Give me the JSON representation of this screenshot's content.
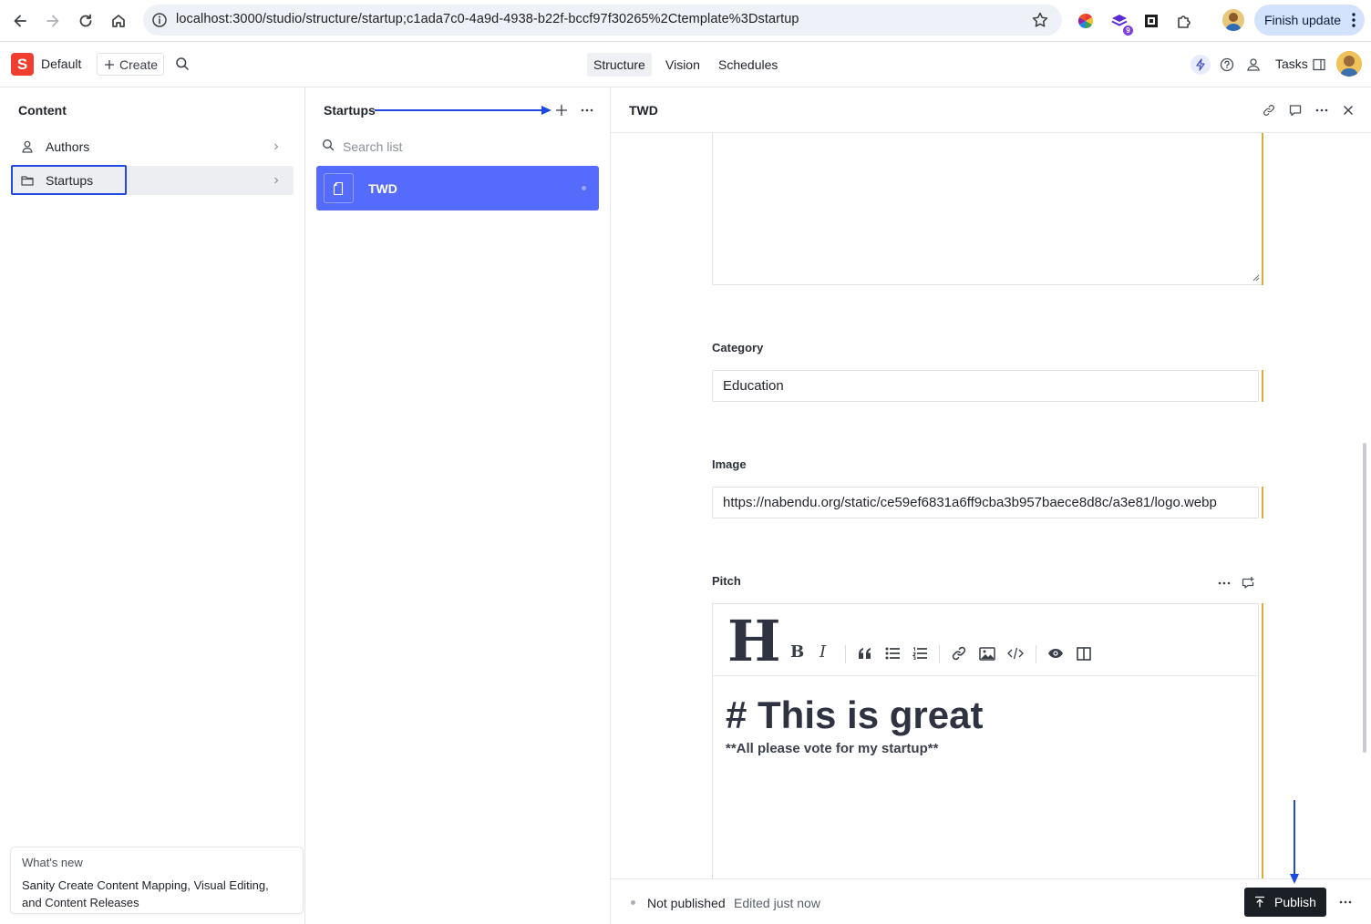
{
  "browser": {
    "url": "localhost:3000/studio/structure/startup;c1ada7c0-4a9d-4938-b22f-bccf97f30265%2Ctemplate%3Dstartup",
    "extension_badge": "9",
    "finish_update_label": "Finish update"
  },
  "studio": {
    "logo_letter": "S",
    "workspace": "Default",
    "create_label": "Create",
    "tabs": [
      {
        "label": "Structure",
        "active": true
      },
      {
        "label": "Vision",
        "active": false
      },
      {
        "label": "Schedules",
        "active": false
      }
    ],
    "tasks_label": "Tasks"
  },
  "content_pane": {
    "title": "Content",
    "items": [
      {
        "label": "Authors",
        "icon": "user-icon",
        "selected": false
      },
      {
        "label": "Startups",
        "icon": "folder-icon",
        "selected": true
      }
    ]
  },
  "whats_new": {
    "heading": "What's new",
    "body": "Sanity Create Content Mapping, Visual Editing, and Content Releases"
  },
  "list_pane": {
    "title": "Startups",
    "search_placeholder": "Search list",
    "documents": [
      {
        "title": "TWD",
        "selected": true
      }
    ]
  },
  "editor": {
    "title": "TWD",
    "fields": {
      "category": {
        "label": "Category",
        "value": "Education"
      },
      "image": {
        "label": "Image",
        "value": "https://nabendu.org/static/ce59ef6831a6ff9cba3b957baece8d8c/a3e81/logo.webp"
      },
      "pitch": {
        "label": "Pitch",
        "toolbar_heading_glyph": "H",
        "toolbar_bold_glyph": "B",
        "toolbar_italic_glyph": "I",
        "heading_text": "# This is great",
        "paragraph_text": "**All please vote for my startup**"
      }
    },
    "footer": {
      "status": "Not published",
      "edited": "Edited just now",
      "publish_label": "Publish"
    }
  },
  "colors": {
    "accent": "#556bfc",
    "annotation_blue": "#1f49e0",
    "change_indicator": "#d6ad38",
    "publish_bg": "#1b1f26",
    "logo_red": "#f03e2f"
  }
}
